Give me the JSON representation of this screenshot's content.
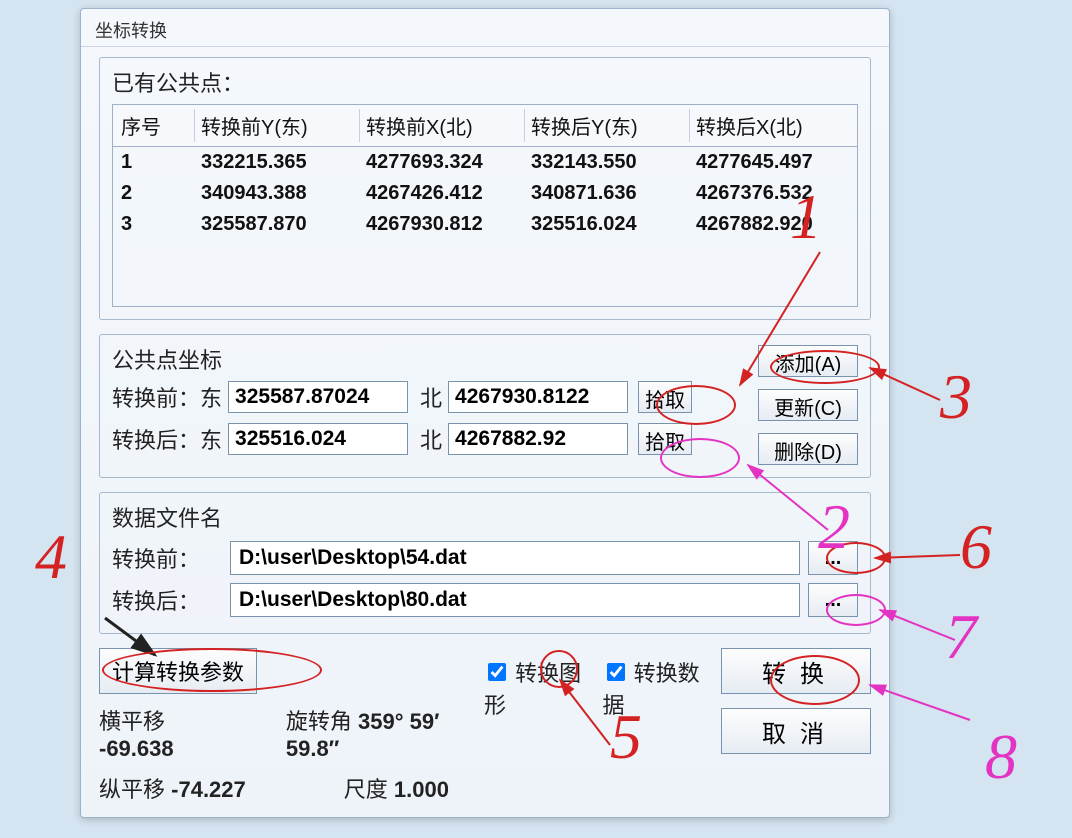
{
  "window": {
    "title": "坐标转换"
  },
  "points_group": {
    "title": "已有公共点：",
    "columns": [
      "序号",
      "转换前Y(东)",
      "转换前X(北)",
      "转换后Y(东)",
      "转换后X(北)"
    ],
    "rows": [
      {
        "idx": "1",
        "preY": "332215.365",
        "preX": "4277693.324",
        "postY": "332143.550",
        "postX": "4277645.497"
      },
      {
        "idx": "2",
        "preY": "340943.388",
        "preX": "4267426.412",
        "postY": "340871.636",
        "postX": "4267376.532"
      },
      {
        "idx": "3",
        "preY": "325587.870",
        "preX": "4267930.812",
        "postY": "325516.024",
        "postX": "4267882.920"
      }
    ]
  },
  "coord_group": {
    "title": "公共点坐标",
    "before_label": "转换前：",
    "after_label": "转换后：",
    "east_label": "东",
    "north_label": "北",
    "before_east": "325587.87024",
    "before_north": "4267930.8122",
    "after_east": "325516.024",
    "after_north": "4267882.92",
    "pick_btn": "拾取",
    "add_btn": "添加(A)",
    "update_btn": "更新(C)",
    "delete_btn": "删除(D)"
  },
  "file_group": {
    "title": "数据文件名",
    "before_label": "转换前：",
    "after_label": "转换后：",
    "before_path": "D:\\user\\Desktop\\54.dat",
    "after_path": "D:\\user\\Desktop\\80.dat",
    "browse": "..."
  },
  "bottom": {
    "calc_btn": "计算转换参数",
    "check_shape": "转换图形",
    "check_data": "转换数据",
    "convert_btn": "转换",
    "cancel_btn": "取消",
    "hshift_label": "横平移",
    "hshift_value": "-69.638",
    "vshift_label": "纵平移",
    "vshift_value": "-74.227",
    "rot_label": "旋转角",
    "rot_value": "359° 59′ 59.8″",
    "scale_label": "尺度",
    "scale_value": "1.000"
  },
  "annotations": {
    "n1": "1",
    "n2": "2",
    "n3": "3",
    "n4": "4",
    "n5": "5",
    "n6": "6",
    "n7": "7",
    "n8": "8"
  }
}
